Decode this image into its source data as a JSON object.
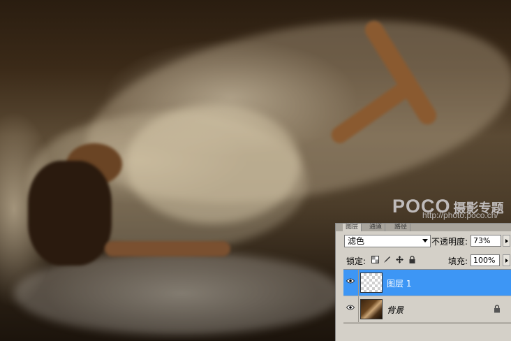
{
  "watermark": {
    "brand": "POCO",
    "brand_cn": "摄影专题",
    "url": "http://photo.poco.cn/"
  },
  "layers_panel": {
    "tabs": [
      {
        "label": "图层",
        "active": true
      },
      {
        "label": "通道",
        "active": false
      },
      {
        "label": "路径",
        "active": false
      }
    ],
    "blend_mode": "滤色",
    "opacity_label": "不透明度:",
    "opacity_value": "73%",
    "lock_label": "锁定:",
    "fill_label": "填充:",
    "fill_value": "100%",
    "layers": [
      {
        "name": "图层 1",
        "selected": true,
        "visible": true,
        "thumbnail": "transparent"
      },
      {
        "name": "背景",
        "selected": false,
        "visible": true,
        "thumbnail": "photo",
        "locked": true
      }
    ],
    "colors": {
      "selection": "#3d96f5",
      "panel_bg": "#d4d0c8"
    }
  },
  "icons": [
    "eye-icon",
    "lock-transparent-icon",
    "lock-paint-icon",
    "lock-move-icon",
    "lock-all-icon",
    "layer-lock-icon",
    "dropdown-arrow-icon"
  ]
}
